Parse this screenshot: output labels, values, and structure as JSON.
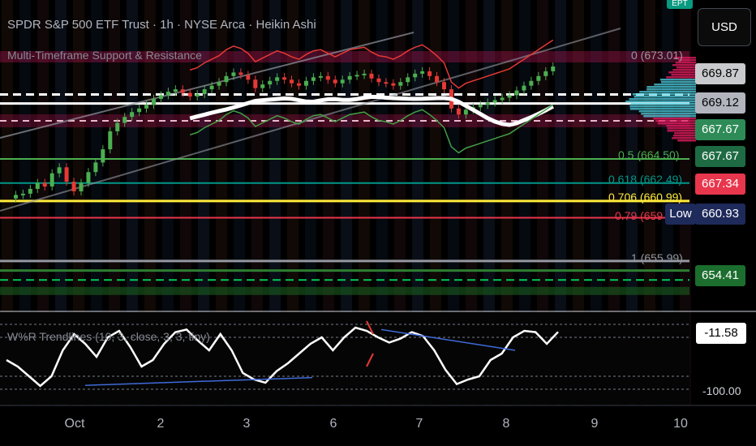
{
  "header": {
    "title": "SPDR S&P 500 ETF Trust · 1h · NYSE Arca · Heikin Ashi",
    "indicator": "Multi-Timeframe Support & Resistance",
    "currency": "USD",
    "corner_badge": "EPT"
  },
  "price_tags": [
    {
      "text": "669.87",
      "bg": "#c9cacd",
      "fg": "#000000"
    },
    {
      "text": "669.12",
      "bg": "#b2b5be",
      "fg": "#000000"
    },
    {
      "text": "667.67",
      "bg": "#2e8b57",
      "fg": "#ffffff"
    },
    {
      "text": "667.67",
      "bg": "#1e6b43",
      "fg": "#ffffff"
    },
    {
      "text": "667.34",
      "bg": "#e8364c",
      "fg": "#ffffff"
    },
    {
      "text": "660.93",
      "bg": "#1e2a5a",
      "fg": "#ffffff"
    },
    {
      "text": "654.41",
      "bg": "#1b6e2d",
      "fg": "#ffffff"
    }
  ],
  "low_label": "Low",
  "fib_levels": [
    {
      "label": "0 (673.01)",
      "color": "#9598a1"
    },
    {
      "label": "0.5 (664.50)",
      "color": "#4caf50"
    },
    {
      "label": "0.618 (662.49)",
      "color": "#009688"
    },
    {
      "label": "0.706 (660.99)",
      "color": "#ffeb3b"
    },
    {
      "label": "0.79 (659",
      "color": "#e8364c"
    },
    {
      "label": "1 (655.99)",
      "color": "#9598a1"
    }
  ],
  "oscillator": {
    "label": "W%R Trendlines (10, 3, close, 3, 3, tiny)",
    "value_tag": "-11.58",
    "scale_low": "-100.00"
  },
  "x_axis": [
    "Oct",
    "2",
    "3",
    "6",
    "7",
    "8",
    "9",
    "10"
  ],
  "chart_data": {
    "type": "candlestick",
    "title": "SPDR S&P 500 ETF Trust · 1h · NYSE Arca · Heikin Ashi",
    "x_ticks": [
      "Oct",
      "2",
      "3",
      "6",
      "7",
      "8",
      "9",
      "10"
    ],
    "y_visible_range": [
      654,
      674
    ],
    "fibonacci_levels": [
      {
        "ratio": 0,
        "price": 673.01
      },
      {
        "ratio": 0.5,
        "price": 664.5
      },
      {
        "ratio": 0.618,
        "price": 662.49
      },
      {
        "ratio": 0.706,
        "price": 660.99
      },
      {
        "ratio": 0.79,
        "price": 659.6
      },
      {
        "ratio": 1,
        "price": 655.99
      }
    ],
    "marked_prices": [
      669.87,
      669.12,
      667.67,
      667.67,
      667.34,
      660.93,
      654.41
    ],
    "heikin_ashi_close_path": [
      661.2,
      661.5,
      661.6,
      662.0,
      662.5,
      662.2,
      663.3,
      663.8,
      662.6,
      661.8,
      662.5,
      663.4,
      664.2,
      665.3,
      666.8,
      667.5,
      668.0,
      668.4,
      668.7,
      669.0,
      669.5,
      669.8,
      670.1,
      670.3,
      670.0,
      669.7,
      669.9,
      670.3,
      670.6,
      670.9,
      671.4,
      671.7,
      671.5,
      671.1,
      670.4,
      670.7,
      671.0,
      671.3,
      671.1,
      670.8,
      670.6,
      671.0,
      671.3,
      671.4,
      671.1,
      670.8,
      671.1,
      671.4,
      671.5,
      671.6,
      671.2,
      670.9,
      670.8,
      670.6,
      670.9,
      671.3,
      671.6,
      671.8,
      671.4,
      670.9,
      670.3,
      668.7,
      668.2,
      668.6,
      668.8,
      669.0,
      669.2,
      669.4,
      669.6,
      669.8,
      670.2,
      670.6,
      671.0,
      671.4,
      671.8,
      672.2
    ],
    "williams_r_series": [
      -55,
      -65,
      -80,
      -95,
      -80,
      -40,
      -15,
      -30,
      -50,
      -20,
      -10,
      -35,
      -65,
      -55,
      -30,
      -12,
      -8,
      -25,
      -40,
      -15,
      -40,
      -75,
      -85,
      -90,
      -72,
      -60,
      -45,
      -30,
      -20,
      -40,
      -20,
      -5,
      -10,
      -20,
      -28,
      -22,
      -12,
      -18,
      -40,
      -70,
      -92,
      -85,
      -80,
      -55,
      -45,
      -20,
      -10,
      -12,
      -30,
      -11.58
    ],
    "williams_r_last": -11.58,
    "williams_r_scale": [
      0,
      -100
    ]
  }
}
